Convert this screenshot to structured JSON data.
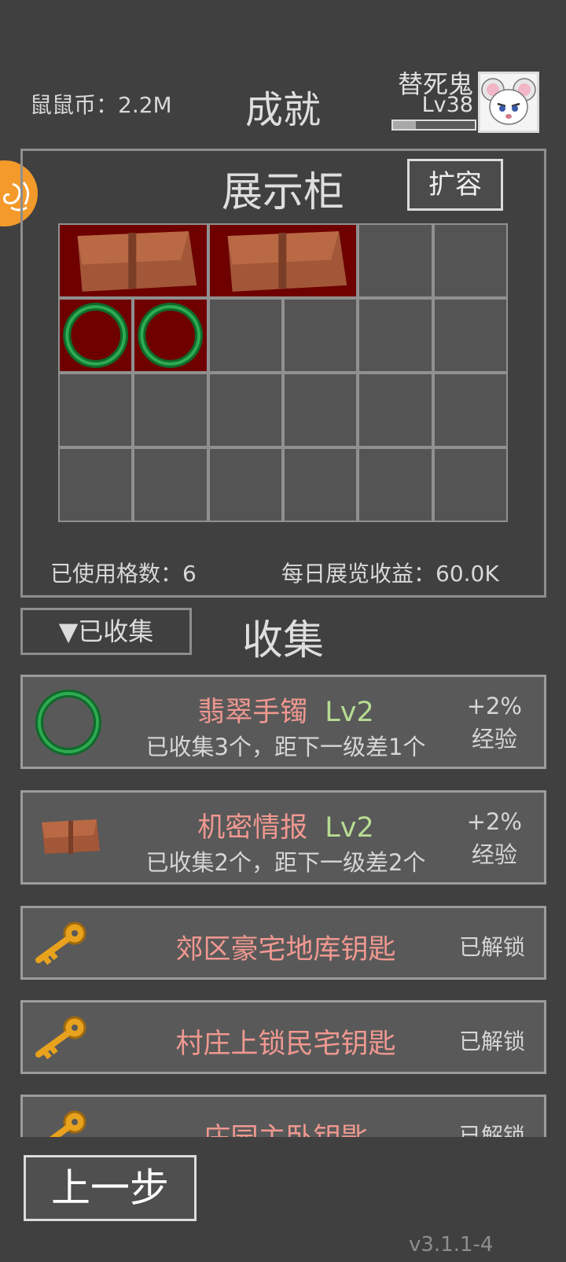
{
  "header": {
    "coins_text": "鼠鼠币：2.2M",
    "title": "成就",
    "player_name": "替死鬼",
    "player_level": "Lv38",
    "xp_progress": 0.28
  },
  "cabinet": {
    "title": "展示柜",
    "expand_label": "扩容",
    "columns": 6,
    "rows": 4,
    "items": [
      {
        "item": "document",
        "col": 0,
        "row": 0,
        "colspan": 2
      },
      {
        "item": "document",
        "col": 2,
        "row": 0,
        "colspan": 2
      },
      {
        "item": "jade-bangle",
        "col": 0,
        "row": 1,
        "colspan": 1
      },
      {
        "item": "jade-bangle",
        "col": 1,
        "row": 1,
        "colspan": 1
      }
    ],
    "used_slots_text": "已使用格数：6",
    "daily_income_text": "每日展览收益：60.0K"
  },
  "collection": {
    "filter_label": "▼已收集",
    "title": "收集",
    "items": [
      {
        "icon": "jade-bangle-icon",
        "name": "翡翠手镯",
        "level": "Lv2",
        "subtitle": "已收集3个，距下一级差1个",
        "bonus": "+2%",
        "bonus_type": "经验"
      },
      {
        "icon": "document-icon",
        "name": "机密情报",
        "level": "Lv2",
        "subtitle": "已收集2个，距下一级差2个",
        "bonus": "+2%",
        "bonus_type": "经验"
      },
      {
        "icon": "key-icon",
        "name": "郊区豪宅地库钥匙",
        "status": "已解锁"
      },
      {
        "icon": "key-icon",
        "name": "村庄上锁民宅钥匙",
        "status": "已解锁"
      },
      {
        "icon": "key-icon",
        "name": "庄园主卧钥匙",
        "status": "已解锁"
      }
    ]
  },
  "footer": {
    "back_label": "上一步",
    "version": "v3.1.1-4"
  },
  "colors": {
    "background": "#404040",
    "item_name": "#f09890",
    "level_green": "#b7dc92",
    "cell_filled": "#6e0000",
    "side_button": "#f49a2a"
  }
}
